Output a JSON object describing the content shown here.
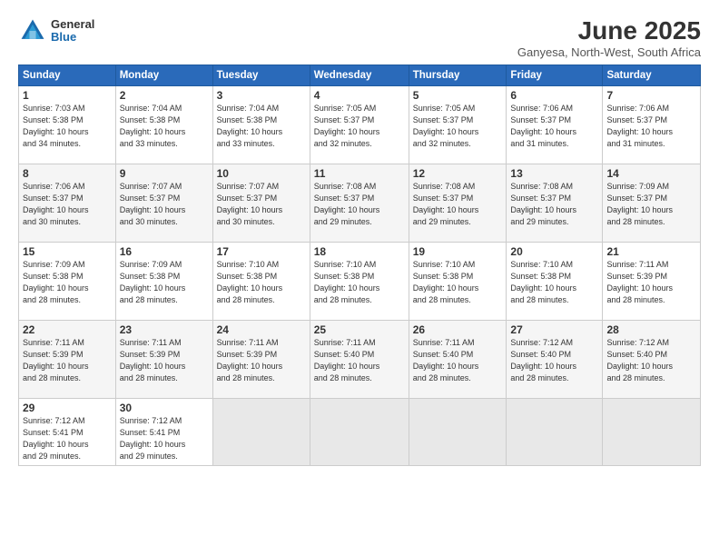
{
  "header": {
    "logo_general": "General",
    "logo_blue": "Blue",
    "month_title": "June 2025",
    "location": "Ganyesa, North-West, South Africa"
  },
  "days_of_week": [
    "Sunday",
    "Monday",
    "Tuesday",
    "Wednesday",
    "Thursday",
    "Friday",
    "Saturday"
  ],
  "weeks": [
    [
      {
        "day": "1",
        "info": "Sunrise: 7:03 AM\nSunset: 5:38 PM\nDaylight: 10 hours\nand 34 minutes."
      },
      {
        "day": "2",
        "info": "Sunrise: 7:04 AM\nSunset: 5:38 PM\nDaylight: 10 hours\nand 33 minutes."
      },
      {
        "day": "3",
        "info": "Sunrise: 7:04 AM\nSunset: 5:38 PM\nDaylight: 10 hours\nand 33 minutes."
      },
      {
        "day": "4",
        "info": "Sunrise: 7:05 AM\nSunset: 5:37 PM\nDaylight: 10 hours\nand 32 minutes."
      },
      {
        "day": "5",
        "info": "Sunrise: 7:05 AM\nSunset: 5:37 PM\nDaylight: 10 hours\nand 32 minutes."
      },
      {
        "day": "6",
        "info": "Sunrise: 7:06 AM\nSunset: 5:37 PM\nDaylight: 10 hours\nand 31 minutes."
      },
      {
        "day": "7",
        "info": "Sunrise: 7:06 AM\nSunset: 5:37 PM\nDaylight: 10 hours\nand 31 minutes."
      }
    ],
    [
      {
        "day": "8",
        "info": "Sunrise: 7:06 AM\nSunset: 5:37 PM\nDaylight: 10 hours\nand 30 minutes."
      },
      {
        "day": "9",
        "info": "Sunrise: 7:07 AM\nSunset: 5:37 PM\nDaylight: 10 hours\nand 30 minutes."
      },
      {
        "day": "10",
        "info": "Sunrise: 7:07 AM\nSunset: 5:37 PM\nDaylight: 10 hours\nand 30 minutes."
      },
      {
        "day": "11",
        "info": "Sunrise: 7:08 AM\nSunset: 5:37 PM\nDaylight: 10 hours\nand 29 minutes."
      },
      {
        "day": "12",
        "info": "Sunrise: 7:08 AM\nSunset: 5:37 PM\nDaylight: 10 hours\nand 29 minutes."
      },
      {
        "day": "13",
        "info": "Sunrise: 7:08 AM\nSunset: 5:37 PM\nDaylight: 10 hours\nand 29 minutes."
      },
      {
        "day": "14",
        "info": "Sunrise: 7:09 AM\nSunset: 5:37 PM\nDaylight: 10 hours\nand 28 minutes."
      }
    ],
    [
      {
        "day": "15",
        "info": "Sunrise: 7:09 AM\nSunset: 5:38 PM\nDaylight: 10 hours\nand 28 minutes."
      },
      {
        "day": "16",
        "info": "Sunrise: 7:09 AM\nSunset: 5:38 PM\nDaylight: 10 hours\nand 28 minutes."
      },
      {
        "day": "17",
        "info": "Sunrise: 7:10 AM\nSunset: 5:38 PM\nDaylight: 10 hours\nand 28 minutes."
      },
      {
        "day": "18",
        "info": "Sunrise: 7:10 AM\nSunset: 5:38 PM\nDaylight: 10 hours\nand 28 minutes."
      },
      {
        "day": "19",
        "info": "Sunrise: 7:10 AM\nSunset: 5:38 PM\nDaylight: 10 hours\nand 28 minutes."
      },
      {
        "day": "20",
        "info": "Sunrise: 7:10 AM\nSunset: 5:38 PM\nDaylight: 10 hours\nand 28 minutes."
      },
      {
        "day": "21",
        "info": "Sunrise: 7:11 AM\nSunset: 5:39 PM\nDaylight: 10 hours\nand 28 minutes."
      }
    ],
    [
      {
        "day": "22",
        "info": "Sunrise: 7:11 AM\nSunset: 5:39 PM\nDaylight: 10 hours\nand 28 minutes."
      },
      {
        "day": "23",
        "info": "Sunrise: 7:11 AM\nSunset: 5:39 PM\nDaylight: 10 hours\nand 28 minutes."
      },
      {
        "day": "24",
        "info": "Sunrise: 7:11 AM\nSunset: 5:39 PM\nDaylight: 10 hours\nand 28 minutes."
      },
      {
        "day": "25",
        "info": "Sunrise: 7:11 AM\nSunset: 5:40 PM\nDaylight: 10 hours\nand 28 minutes."
      },
      {
        "day": "26",
        "info": "Sunrise: 7:11 AM\nSunset: 5:40 PM\nDaylight: 10 hours\nand 28 minutes."
      },
      {
        "day": "27",
        "info": "Sunrise: 7:12 AM\nSunset: 5:40 PM\nDaylight: 10 hours\nand 28 minutes."
      },
      {
        "day": "28",
        "info": "Sunrise: 7:12 AM\nSunset: 5:40 PM\nDaylight: 10 hours\nand 28 minutes."
      }
    ],
    [
      {
        "day": "29",
        "info": "Sunrise: 7:12 AM\nSunset: 5:41 PM\nDaylight: 10 hours\nand 29 minutes."
      },
      {
        "day": "30",
        "info": "Sunrise: 7:12 AM\nSunset: 5:41 PM\nDaylight: 10 hours\nand 29 minutes."
      },
      {
        "day": "",
        "info": ""
      },
      {
        "day": "",
        "info": ""
      },
      {
        "day": "",
        "info": ""
      },
      {
        "day": "",
        "info": ""
      },
      {
        "day": "",
        "info": ""
      }
    ]
  ]
}
